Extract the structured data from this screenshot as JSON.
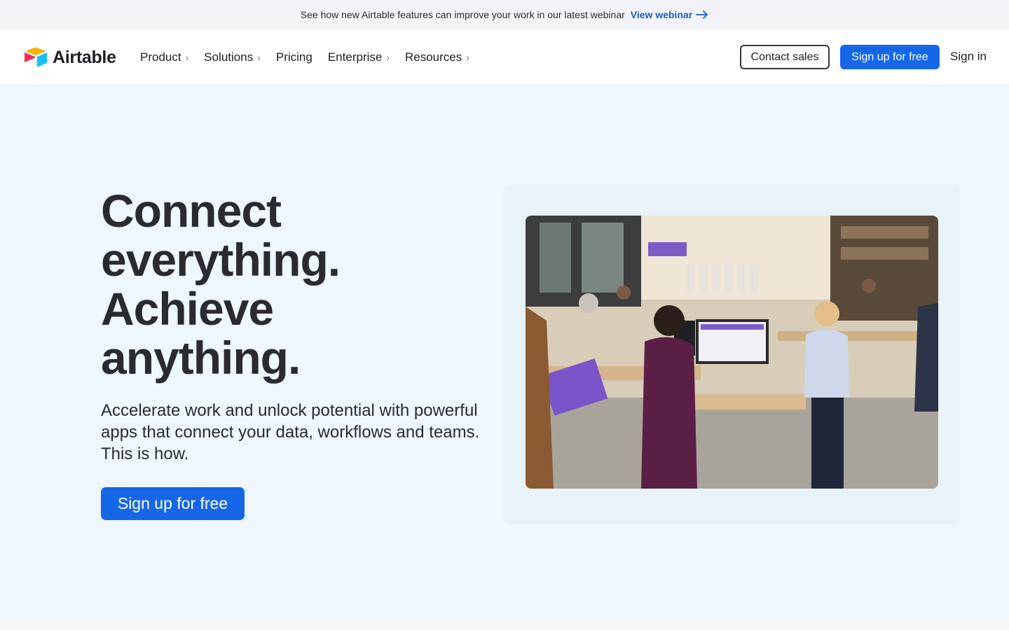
{
  "announcement": {
    "text": "See how new Airtable features can improve your work in our latest webinar",
    "link_label": "View webinar",
    "link_icon": "arrow-right-icon"
  },
  "header": {
    "logo_text": "Airtable",
    "nav": [
      {
        "label": "Product",
        "has_submenu": true
      },
      {
        "label": "Solutions",
        "has_submenu": true
      },
      {
        "label": "Pricing",
        "has_submenu": false
      },
      {
        "label": "Enterprise",
        "has_submenu": true
      },
      {
        "label": "Resources",
        "has_submenu": true
      }
    ],
    "chevron_glyph": "›",
    "contact_label": "Contact sales",
    "signup_label": "Sign up for free",
    "signin_label": "Sign in"
  },
  "hero": {
    "headline_lines": [
      "Connect",
      "everything.",
      "Achieve",
      "anything."
    ],
    "subhead": "Accelerate work and unlock potential with powerful apps that connect your data, workflows and teams. This is how.",
    "cta_label": "Sign up for free"
  },
  "colors": {
    "accent": "#1667e8",
    "link": "#1760c8",
    "page_bg": "#eef7fd",
    "text": "#1d1f25"
  }
}
